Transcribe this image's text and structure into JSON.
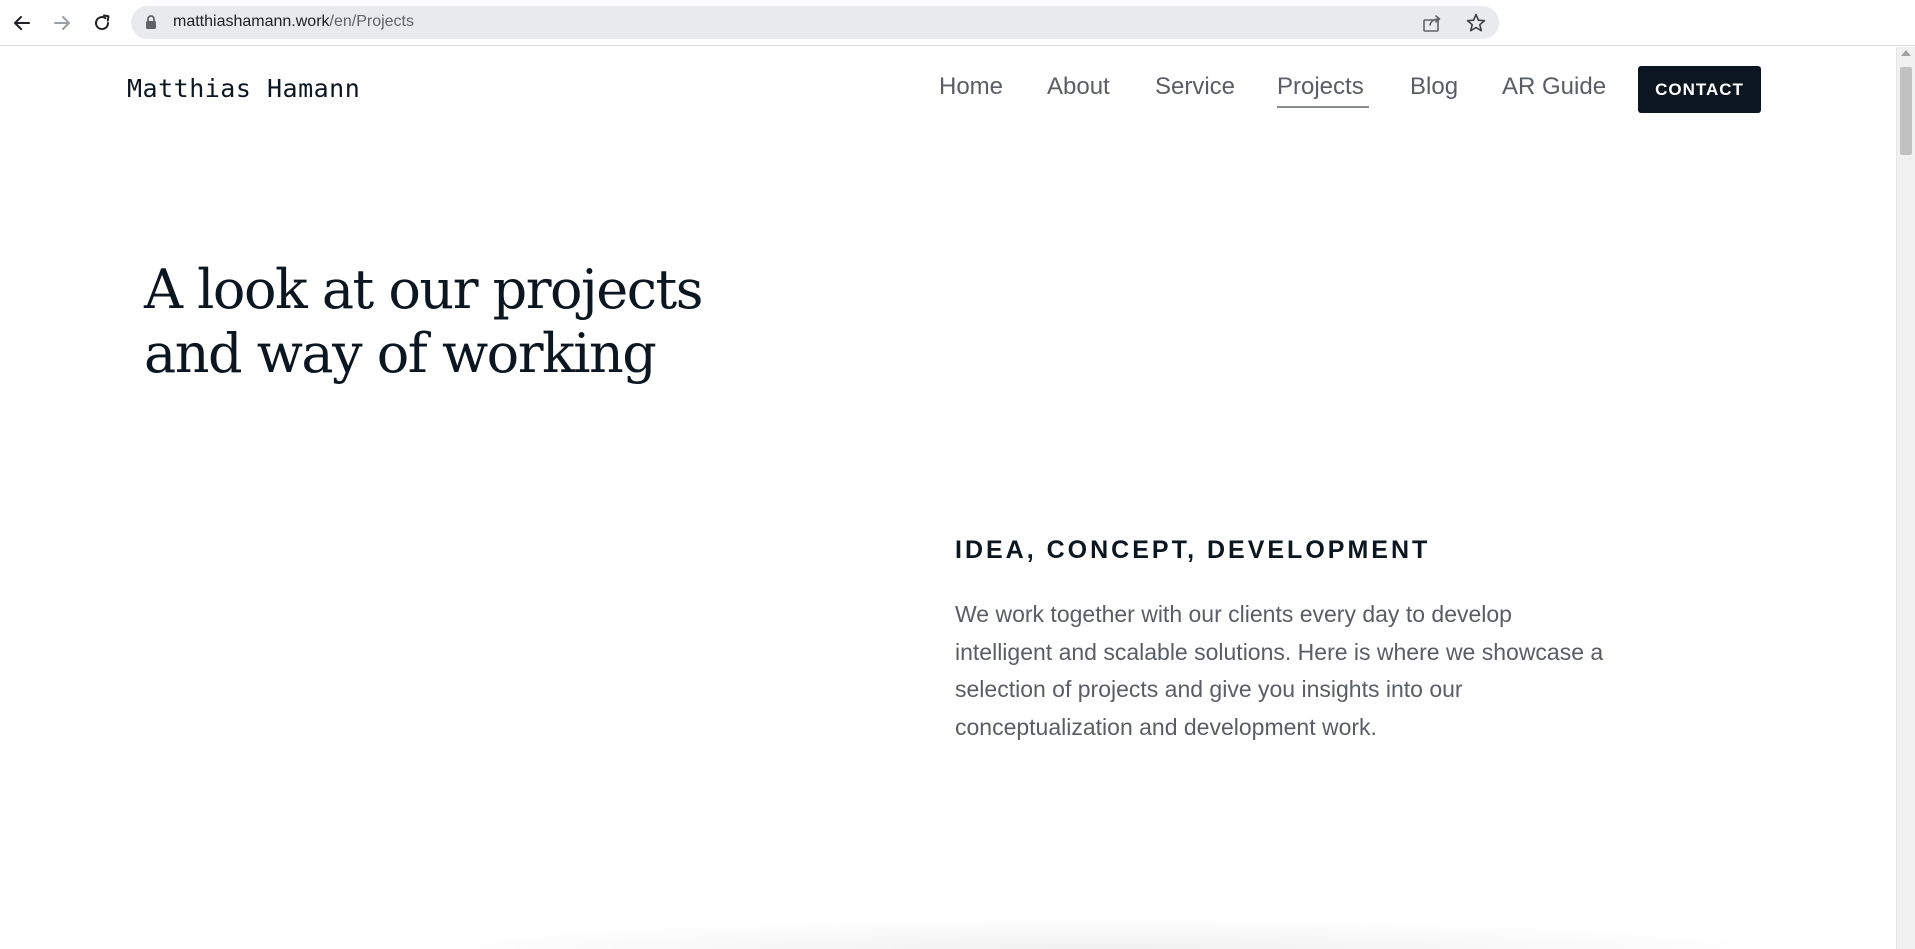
{
  "browser": {
    "url_host": "matthiashamann.work",
    "url_path": "/en/Projects",
    "icons": {
      "back": "arrow-left-icon",
      "forward": "arrow-right-icon",
      "reload": "reload-icon",
      "lock": "lock-icon",
      "share": "share-icon",
      "bookmark": "star-icon"
    }
  },
  "site": {
    "logo": "Matthias Hamann",
    "nav": {
      "home": "Home",
      "about": "About",
      "service": "Service",
      "projects": "Projects",
      "blog": "Blog",
      "ar_guide": "AR Guide",
      "active": "Projects"
    },
    "contact_label": "CONTACT",
    "colors": {
      "primary_dark": "#0c1620",
      "text_muted": "#5a5d63"
    }
  },
  "hero": {
    "heading": "A look at our projects and way of working"
  },
  "intro": {
    "label": "IDEA, CONCEPT, DEVELOPMENT",
    "body": "We work together with our clients every day to develop intelligent and scalable solutions. Here is where we showcase a selection of projects and give you insights into our conceptualization and development work."
  }
}
